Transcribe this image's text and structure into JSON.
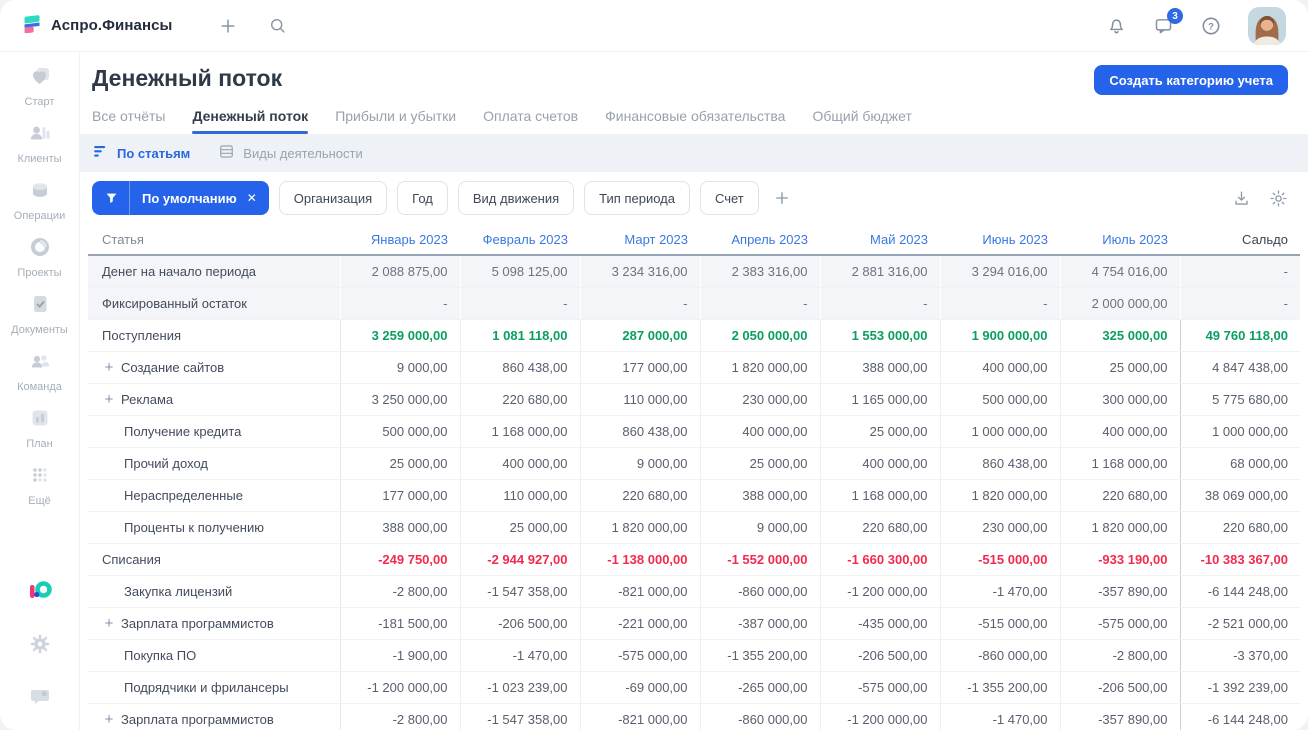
{
  "app": {
    "name": "Аспро.Финансы"
  },
  "topbar": {
    "chat_badge": "3"
  },
  "sidebar": {
    "items": [
      {
        "id": "start",
        "icon": "start",
        "label": "Старт"
      },
      {
        "id": "clients",
        "icon": "clients",
        "label": "Клиенты"
      },
      {
        "id": "operations",
        "icon": "operations",
        "label": "Операции"
      },
      {
        "id": "projects",
        "icon": "projects",
        "label": "Проекты"
      },
      {
        "id": "documents",
        "icon": "documents",
        "label": "Документы"
      },
      {
        "id": "team",
        "icon": "team",
        "label": "Команда"
      },
      {
        "id": "plan",
        "icon": "plan",
        "label": "План"
      },
      {
        "id": "more",
        "icon": "more",
        "label": "Ещё"
      }
    ]
  },
  "page": {
    "title": "Денежный поток",
    "create_button": "Создать категорию учета"
  },
  "tabs": [
    {
      "id": "all-reports",
      "label": "Все отчёты",
      "active": false
    },
    {
      "id": "cash-flow",
      "label": "Денежный поток",
      "active": true
    },
    {
      "id": "profit-loss",
      "label": "Прибыли и убытки",
      "active": false
    },
    {
      "id": "bill-payment",
      "label": "Оплата счетов",
      "active": false
    },
    {
      "id": "liabilities",
      "label": "Финансовые обязательства",
      "active": false
    },
    {
      "id": "total-budget",
      "label": "Общий бюджет",
      "active": false
    }
  ],
  "view_tabs": [
    {
      "id": "by-articles",
      "icon": "sort",
      "label": "По статьям",
      "active": true
    },
    {
      "id": "by-activity",
      "icon": "db",
      "label": "Виды деятельности",
      "active": false
    }
  ],
  "filters": {
    "active_chip": {
      "label": "По умолчанию"
    },
    "chips": [
      "Организация",
      "Год",
      "Вид движения",
      "Тип периода",
      "Счет"
    ]
  },
  "table": {
    "columns": [
      "Статья",
      "Январь 2023",
      "Февраль 2023",
      "Март 2023",
      "Апрель 2023",
      "Май 2023",
      "Июнь 2023",
      "Июль 2023",
      "Сальдо"
    ],
    "rows": [
      {
        "label": "Денег на начало периода",
        "type": "opening",
        "expandable": false,
        "indent": false,
        "values": [
          "2 088 875,00",
          "5 098 125,00",
          "3 234 316,00",
          "2 383 316,00",
          "2 881 316,00",
          "3 294 016,00",
          "4 754 016,00",
          "-"
        ]
      },
      {
        "label": "Фиксированный остаток",
        "type": "opening",
        "expandable": false,
        "indent": false,
        "values": [
          "-",
          "-",
          "-",
          "-",
          "-",
          "-",
          "2 000 000,00",
          "-"
        ]
      },
      {
        "label": "Поступления",
        "type": "income",
        "expandable": false,
        "indent": false,
        "values": [
          "3 259 000,00",
          "1 081 118,00",
          "287 000,00",
          "2 050 000,00",
          "1 553 000,00",
          "1 900 000,00",
          "325 000,00",
          "49 760 118,00"
        ]
      },
      {
        "label": "Создание сайтов",
        "type": "item",
        "expandable": true,
        "indent": false,
        "values": [
          "9 000,00",
          "860 438,00",
          "177 000,00",
          "1 820 000,00",
          "388 000,00",
          "400 000,00",
          "25 000,00",
          "4 847 438,00"
        ]
      },
      {
        "label": "Реклама",
        "type": "item",
        "expandable": true,
        "indent": false,
        "values": [
          "3 250 000,00",
          "220 680,00",
          "110 000,00",
          "230 000,00",
          "1 165 000,00",
          "500 000,00",
          "300 000,00",
          "5 775 680,00"
        ]
      },
      {
        "label": "Получение кредита",
        "type": "item",
        "expandable": false,
        "indent": true,
        "values": [
          "500 000,00",
          "1 168 000,00",
          "860 438,00",
          "400 000,00",
          "25 000,00",
          "1 000 000,00",
          "400 000,00",
          "1 000 000,00"
        ]
      },
      {
        "label": "Прочий доход",
        "type": "item",
        "expandable": false,
        "indent": true,
        "values": [
          "25 000,00",
          "400 000,00",
          "9 000,00",
          "25 000,00",
          "400 000,00",
          "860 438,00",
          "1 168 000,00",
          "68 000,00"
        ]
      },
      {
        "label": "Нераспределенные",
        "type": "item",
        "expandable": false,
        "indent": true,
        "values": [
          "177 000,00",
          "110 000,00",
          "220 680,00",
          "388 000,00",
          "1 168 000,00",
          "1 820 000,00",
          "220 680,00",
          "38 069 000,00"
        ]
      },
      {
        "label": "Проценты к получению",
        "type": "item",
        "expandable": false,
        "indent": true,
        "values": [
          "388 000,00",
          "25 000,00",
          "1 820 000,00",
          "9 000,00",
          "220 680,00",
          "230 000,00",
          "1 820 000,00",
          "220 680,00"
        ]
      },
      {
        "label": "Списания",
        "type": "expense",
        "expandable": false,
        "indent": false,
        "values": [
          "-249 750,00",
          "-2 944 927,00",
          "-1 138 000,00",
          "-1 552 000,00",
          "-1 660 300,00",
          "-515 000,00",
          "-933 190,00",
          "-10 383 367,00"
        ]
      },
      {
        "label": "Закупка лицензий",
        "type": "item",
        "expandable": false,
        "indent": true,
        "values": [
          "-2 800,00",
          "-1 547 358,00",
          "-821 000,00",
          "-860 000,00",
          "-1 200 000,00",
          "-1 470,00",
          "-357 890,00",
          "-6 144 248,00"
        ]
      },
      {
        "label": "Зарплата программистов",
        "type": "item",
        "expandable": true,
        "indent": false,
        "values": [
          "-181 500,00",
          "-206 500,00",
          "-221 000,00",
          "-387 000,00",
          "-435 000,00",
          "-515 000,00",
          "-575 000,00",
          "-2 521 000,00"
        ]
      },
      {
        "label": "Покупка ПО",
        "type": "item",
        "expandable": false,
        "indent": true,
        "values": [
          "-1 900,00",
          "-1 470,00",
          "-575 000,00",
          "-1 355 200,00",
          "-206 500,00",
          "-860 000,00",
          "-2 800,00",
          "-3 370,00"
        ]
      },
      {
        "label": "Подрядчики и фрилансеры",
        "type": "item",
        "expandable": false,
        "indent": true,
        "values": [
          "-1 200 000,00",
          "-1 023 239,00",
          "-69 000,00",
          "-265 000,00",
          "-575 000,00",
          "-1 355 200,00",
          "-206 500,00",
          "-1 392 239,00"
        ]
      },
      {
        "label": "Зарплата программистов",
        "type": "item",
        "expandable": true,
        "indent": false,
        "values": [
          "-2 800,00",
          "-1 547 358,00",
          "-821 000,00",
          "-860 000,00",
          "-1 200 000,00",
          "-1 470,00",
          "-357 890,00",
          "-6 144 248,00"
        ]
      }
    ]
  },
  "colors": {
    "accent": "#2563eb",
    "income": "#0a9f60",
    "expense": "#f22a50",
    "month_header": "#3a78e0"
  }
}
